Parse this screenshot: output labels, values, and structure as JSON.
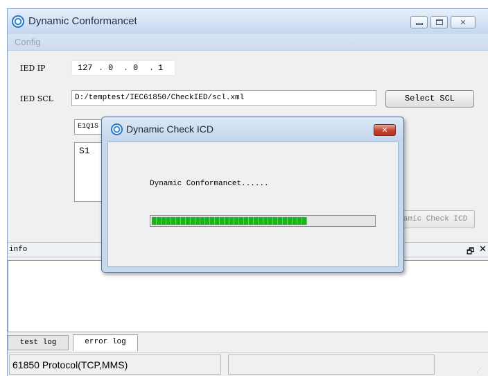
{
  "window": {
    "title": "Dynamic Conformancet",
    "menu": [
      "Config"
    ]
  },
  "form": {
    "ied_ip_label": "IED IP",
    "ip_octets": [
      "127",
      "0",
      "0",
      "1"
    ],
    "ip_separator": ".",
    "ied_scl_label": "IED SCL",
    "scl_path": "D:/temptest/IEC61850/CheckIED/scl.xml",
    "select_scl_button": "Select SCL",
    "combo_value": "E1Q1S",
    "list_items": [
      "S1"
    ],
    "check_button": "amic Check ICD"
  },
  "info_panel": {
    "title": "info",
    "float_glyph": "🗗",
    "close_glyph": "✕"
  },
  "tabs": [
    "test log",
    "error log"
  ],
  "status": {
    "protocol": "61850 Protocol(TCP,MMS)",
    "secondary": ""
  },
  "dialog": {
    "title": "Dynamic Check ICD",
    "close_glyph": "✕",
    "message": "Dynamic Conformancet......",
    "progress_fraction": 0.7
  },
  "colors": {
    "accent": "#3a8ed8",
    "progress": "#19b419",
    "close_red": "#c4402c"
  },
  "icons": {
    "app": "app-logo-icon",
    "dialog": "app-logo-icon"
  }
}
